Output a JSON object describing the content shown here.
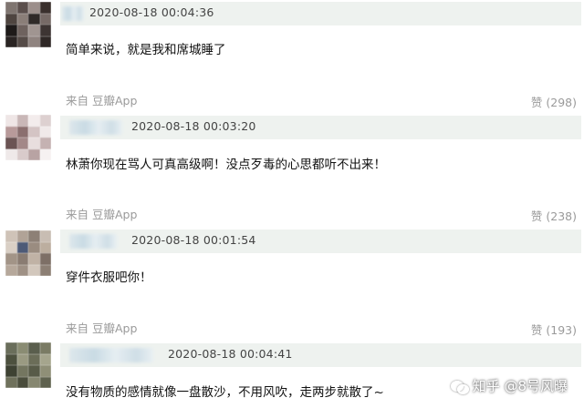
{
  "comments": [
    {
      "time": "2020-08-18 00:04:36",
      "text": "简单来说，就是我和席城睡了",
      "source": "来自 豆瓣App",
      "likes": "赞 (298)"
    },
    {
      "time": "2020-08-18 00:03:20",
      "text": "林萧你现在骂人可真高级啊！没点歹毒的心思都听不出来！",
      "source": "来自 豆瓣App",
      "likes": "赞 (238)"
    },
    {
      "time": "2020-08-18 00:01:54",
      "text": "穿件衣服吧你！",
      "source": "来自 豆瓣App",
      "likes": "赞 (193)"
    },
    {
      "time": "2020-08-18 00:04:41",
      "text": "没有物质的感情就像一盘散沙，不用风吹，走两步就散了~"
    }
  ],
  "watermark": {
    "text": "知乎 @8号风曝",
    "icon": "wechat-icon"
  }
}
